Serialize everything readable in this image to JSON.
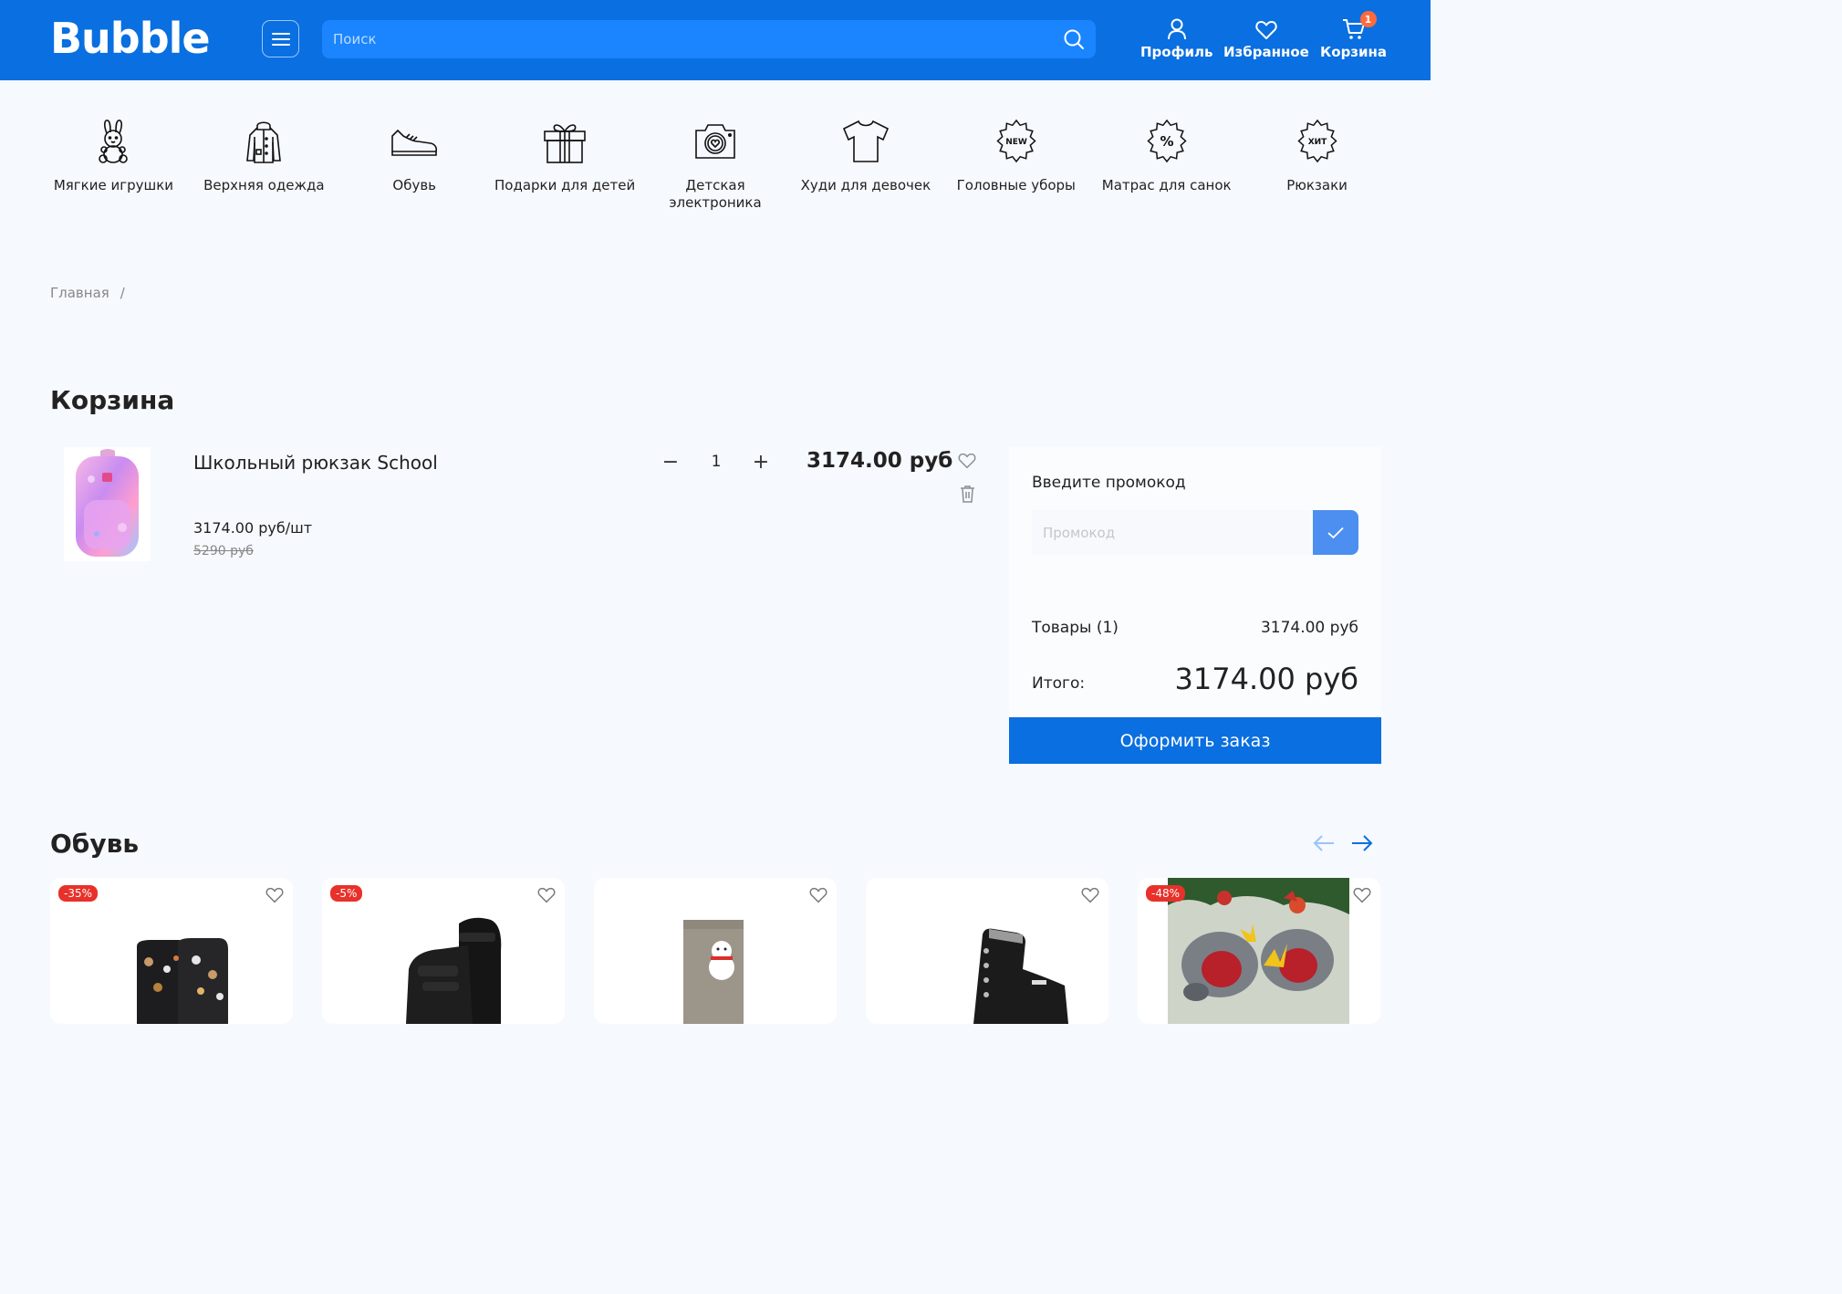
{
  "header": {
    "logo": "Bubble",
    "search_placeholder": "Поиск",
    "profile_label": "Профиль",
    "favorites_label": "Избранное",
    "cart_label": "Корзина",
    "cart_count": "1",
    "brand_color": "#0a6fe0"
  },
  "categories": [
    {
      "label": "Мягкие игрушки",
      "icon": "bunny-icon"
    },
    {
      "label": "Верхняя одежда",
      "icon": "jacket-icon"
    },
    {
      "label": "Обувь",
      "icon": "sneaker-icon"
    },
    {
      "label": "Подарки для детей",
      "icon": "gift-icon"
    },
    {
      "label": "Детская электроника",
      "icon": "camera-icon"
    },
    {
      "label": "Худи для девочек",
      "icon": "tshirt-icon"
    },
    {
      "label": "Головные уборы",
      "icon": "new-badge-icon",
      "icon_text": "NEW"
    },
    {
      "label": "Матрас для санок",
      "icon": "percent-badge-icon",
      "icon_text": "%"
    },
    {
      "label": "Рюкзаки",
      "icon": "hit-badge-icon",
      "icon_text": "ХИТ"
    }
  ],
  "breadcrumb": {
    "home": "Главная",
    "separator": "/"
  },
  "page_title": "Корзина",
  "cart_item": {
    "name": "Школьный рюкзак School",
    "unit_price": "3174.00 руб/шт",
    "old_price": "5290 руб",
    "quantity": "1",
    "minus": "−",
    "plus": "+",
    "total": "3174.00 руб"
  },
  "summary": {
    "promo_title": "Введите промокод",
    "promo_placeholder": "Промокод",
    "goods_label": "Товары (1)",
    "goods_value": "3174.00 руб",
    "total_label": "Итого:",
    "total_value": "3174.00 руб",
    "checkout_label": "Оформить заказ"
  },
  "shoes_section": {
    "title": "Обувь",
    "products": [
      {
        "discount": "-35%",
        "image": "winter-boots-pattern"
      },
      {
        "discount": "-5%",
        "image": "black-sneakers"
      },
      {
        "discount": "",
        "image": "felt-boots-snowman"
      },
      {
        "discount": "",
        "image": "black-winter-boots"
      },
      {
        "discount": "-48%",
        "image": "reindeer-slippers"
      }
    ]
  },
  "colors": {
    "discount_badge": "#e8312a",
    "cart_badge": "#ff6a3d",
    "promo_button": "#4d8ff0"
  }
}
